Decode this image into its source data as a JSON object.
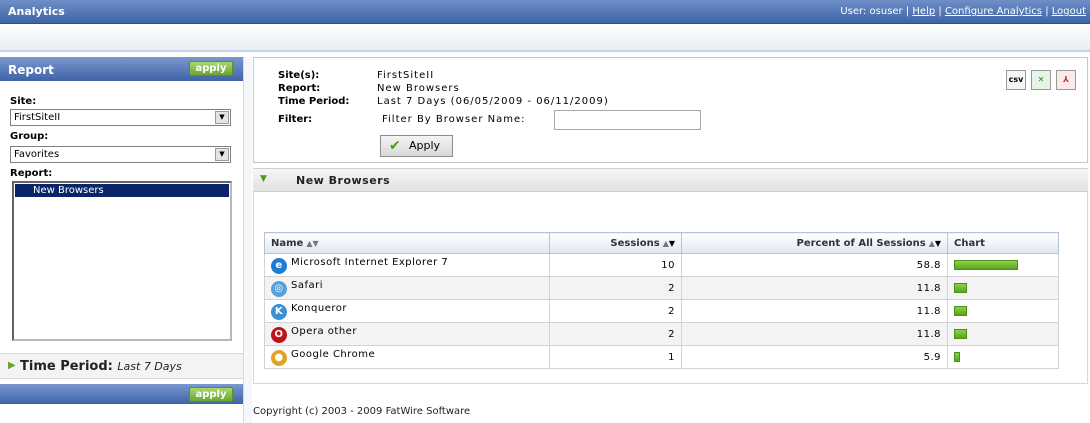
{
  "topbar": {
    "app_title": "Analytics",
    "user_text": "User: osuser |",
    "links": [
      "Help",
      "Configure Analytics",
      "Logout"
    ]
  },
  "report_panel": {
    "title": "Report",
    "apply_label": "apply",
    "site_label": "Site:",
    "site_value": "FirstSiteII",
    "group_label": "Group:",
    "group_value": "Favorites",
    "report_label": "Report:",
    "report_items": [
      "New Browsers"
    ],
    "time_period_label": "Time Period:",
    "time_period_value": "Last 7 Days",
    "bottom_apply_label": "apply"
  },
  "criteria": {
    "sites_label": "Site(s):",
    "sites_value": "FirstSiteII",
    "report_label": "Report:",
    "report_value": "New Browsers",
    "period_label": "Time Period:",
    "period_value": "Last 7 Days (06/05/2009 - 06/11/2009)",
    "filter_label": "Filter:",
    "filter_by_label": "Filter By Browser Name:",
    "filter_value": "",
    "apply_label": "Apply",
    "exports": [
      "csv",
      "excel",
      "pdf"
    ]
  },
  "section": {
    "title": "New Browsers"
  },
  "table": {
    "headers": [
      "Name",
      "Sessions",
      "Percent of All Sessions",
      "Chart"
    ],
    "rows": [
      {
        "name": "Microsoft Internet Explorer 7",
        "sessions": "10",
        "percent": "58.8",
        "icon": "ie-icon",
        "share": 58.8
      },
      {
        "name": "Safari",
        "sessions": "2",
        "percent": "11.8",
        "icon": "safari-icon",
        "share": 11.8
      },
      {
        "name": "Konqueror",
        "sessions": "2",
        "percent": "11.8",
        "icon": "konqueror-icon",
        "share": 11.8
      },
      {
        "name": "Opera other",
        "sessions": "2",
        "percent": "11.8",
        "icon": "opera-icon",
        "share": 11.8
      },
      {
        "name": "Google Chrome",
        "sessions": "1",
        "percent": "5.9",
        "icon": "chrome-icon",
        "share": 5.9
      }
    ]
  },
  "footer": {
    "copyright": "Copyright (c) 2003 - 2009 FatWire Software"
  },
  "colors": {
    "header_blue": "#3e63a6",
    "apply_green": "#6aa531",
    "bar_green": "#5aa320",
    "selection": "#0a246a"
  }
}
